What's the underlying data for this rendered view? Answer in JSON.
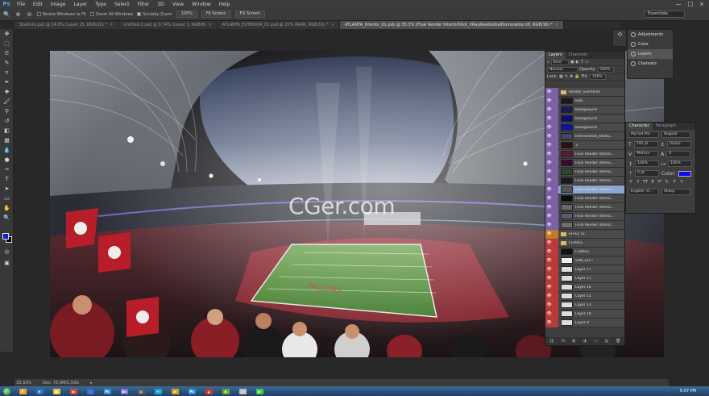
{
  "app": {
    "logo": "Ps",
    "menu": [
      "File",
      "Edit",
      "Image",
      "Layer",
      "Type",
      "Select",
      "Filter",
      "3D",
      "View",
      "Window",
      "Help"
    ],
    "window_controls": [
      "—",
      "□",
      "×"
    ]
  },
  "options": {
    "resize_windows": "Resize Windows to Fit",
    "zoom_all": "Zoom All Windows",
    "scrubby_zoom": "Scrubby Zoom",
    "btn_100": "100%",
    "btn_fit": "Fit Screen",
    "btn_fill": "Fill Screen",
    "workspace": "Essentials"
  },
  "tabs": [
    {
      "label": "Stadium.psd @ 24.9% (Layer 25, RGB/16) *",
      "active": false
    },
    {
      "label": "Untitled-1.psd @ 9.74% (Layer 1, RGB/8)",
      "active": false
    },
    {
      "label": "ATLANTA_EXTERIOR_01.psd @ 25% (RAIN, RGB/16) *",
      "active": false
    },
    {
      "label": "ATLANTA_Interior_01.psb @ 33.3% (Final Render InteriorShot_VRayRawGlobalIllumination.tif, RGB/16) *",
      "active": true
    }
  ],
  "watermark": "CGer.com",
  "status": {
    "zoom": "33.33%",
    "doc": "Doc: 75.9M/1.50G"
  },
  "dock_panels": [
    {
      "label": "Adjustments"
    },
    {
      "label": "Color"
    },
    {
      "label": "Layers",
      "active": true
    },
    {
      "label": "Channels"
    }
  ],
  "layers_panel": {
    "tabs": [
      "Layers",
      "Channels"
    ],
    "kind": "Kind",
    "blend": "Normal",
    "opacity_label": "Opacity:",
    "opacity": "100%",
    "lock_label": "Lock:",
    "fill_label": "Fill:",
    "fill": "100%",
    "layers": [
      {
        "name": "Render_Elements",
        "group": true,
        "color": "#7d5fa6"
      },
      {
        "name": "leds",
        "color": "#7d5fa6",
        "thumb": "#1a1a1a"
      },
      {
        "name": "Background",
        "color": "#7d5fa6",
        "thumb": "#1a1a5a"
      },
      {
        "name": "Background",
        "color": "#7d5fa6",
        "thumb": "#0a0a7a"
      },
      {
        "name": "Background",
        "color": "#7d5fa6",
        "thumb": "#1010b0"
      },
      {
        "name": "InteriorShot_Stadiu...",
        "color": "#7d5fa6",
        "thumb": "#404a66"
      },
      {
        "name": "3",
        "color": "#7d5fa6",
        "thumb": "#2a1010"
      },
      {
        "name": "Final Render Interio...",
        "color": "#7d5fa6",
        "thumb": "#5a1a3a"
      },
      {
        "name": "Final Render Interio...",
        "color": "#7d5fa6",
        "thumb": "#3a0a2a"
      },
      {
        "name": "Final Render Interio...",
        "color": "#7d5fa6",
        "thumb": "#2a4a2a"
      },
      {
        "name": "Final Render Interio...",
        "color": "#7d5fa6",
        "thumb": "#1a1a1a"
      },
      {
        "name": "Final Render Interio...",
        "color": "#7d5fa6",
        "thumb": "#555",
        "selected": true
      },
      {
        "name": "Final Render Interio...",
        "color": "#7d5fa6",
        "thumb": "#0a0a0a"
      },
      {
        "name": "Final Render Interio...",
        "color": "#7d5fa6",
        "thumb": "#6a6a6a"
      },
      {
        "name": "Final Render Interio...",
        "color": "#7d5fa6",
        "thumb": "#5a5a6a"
      },
      {
        "name": "Final Render Interio...",
        "color": "#7d5fa6",
        "thumb": "#707070"
      },
      {
        "name": "EFFECTS",
        "group": true,
        "color": "#c07a28"
      },
      {
        "name": "FLARES",
        "group": true,
        "color": "#b93a3a"
      },
      {
        "name": "FLARES",
        "color": "#b93a3a",
        "thumb": "#111"
      },
      {
        "name": "SUN_LEFT",
        "color": "#b93a3a",
        "thumb": "#eee"
      },
      {
        "name": "Layer 17",
        "color": "#b93a3a",
        "thumb": "#ddd"
      },
      {
        "name": "Layer 27",
        "color": "#b93a3a",
        "thumb": "#ddd"
      },
      {
        "name": "Layer 16",
        "color": "#b93a3a",
        "thumb": "#ddd"
      },
      {
        "name": "Layer 15",
        "color": "#b93a3a",
        "thumb": "#ddd"
      },
      {
        "name": "Layer 13",
        "color": "#b93a3a",
        "thumb": "#ddd"
      },
      {
        "name": "Layer 10",
        "color": "#b93a3a",
        "thumb": "#ddd"
      },
      {
        "name": "Layer 9",
        "color": "#b93a3a",
        "thumb": "#ddd"
      }
    ],
    "footer": [
      "⛓",
      "fx",
      "◐",
      "◑",
      "▭",
      "▤",
      "🗑"
    ]
  },
  "character_panel": {
    "tabs": [
      "Character",
      "Paragraph"
    ],
    "font": "Myriad Pro",
    "style": "Regular",
    "size": "100 pt",
    "leading": "(Auto)",
    "kerning": "Metrics",
    "tracking": "0",
    "vscale": "100%",
    "hscale": "100%",
    "baseline": "0 pt",
    "color_label": "Color:",
    "language": "English: U...",
    "aa": "Sharp",
    "styles": [
      "T",
      "T",
      "TT",
      "Tr",
      "T¹",
      "T₁",
      "T",
      "T"
    ]
  },
  "taskbar": {
    "apps": [
      {
        "color": "#f0a030",
        "label": "F"
      },
      {
        "color": "#2a73c8",
        "label": "e"
      },
      {
        "color": "#e8c24a",
        "label": "▣"
      },
      {
        "color": "#d04a3a",
        "label": "◉"
      },
      {
        "color": "#3a6ad0",
        "label": "◌"
      },
      {
        "color": "#2f8cd8",
        "label": "Ps"
      },
      {
        "color": "#8a6ad0",
        "label": "Ae"
      },
      {
        "color": "#5a5a5a",
        "label": "▤"
      },
      {
        "color": "#2aa0d8",
        "label": "✦"
      },
      {
        "color": "#d8a020",
        "label": "▰"
      },
      {
        "color": "#2f8cd8",
        "label": "Ps"
      },
      {
        "color": "#c83a2a",
        "label": "▲"
      },
      {
        "color": "#6aaa2a",
        "label": "◆"
      },
      {
        "color": "#c0c0c0",
        "label": "▭"
      },
      {
        "color": "#4ac84a",
        "label": "▶"
      }
    ],
    "clock": "5:07 PM"
  }
}
